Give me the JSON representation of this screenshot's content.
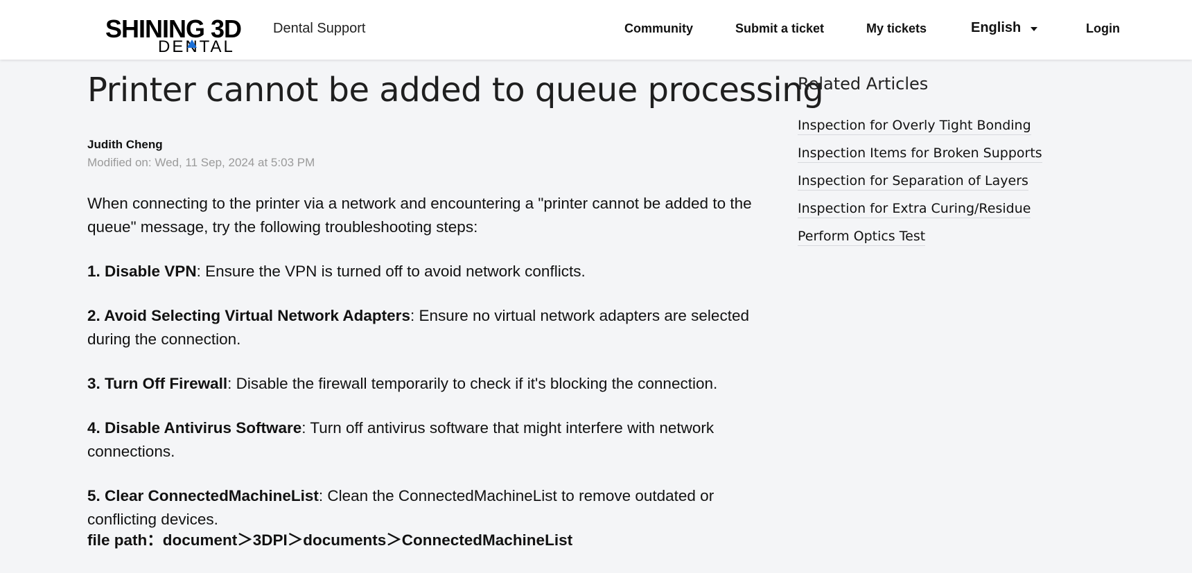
{
  "header": {
    "logo_line1": "SHINING 3D",
    "logo_line2": "DENTAL",
    "brand_sub": "Dental Support",
    "nav": {
      "community": "Community",
      "submit_ticket": "Submit a ticket",
      "my_tickets": "My tickets",
      "language": "English",
      "login": "Login"
    }
  },
  "article": {
    "title": "Printer cannot be added to queue processing",
    "author": "Judith Cheng",
    "modified": "Modified on: Wed, 11 Sep, 2024 at 5:03 PM",
    "intro": "When connecting to the printer via a network and encountering a \"printer cannot be added to the queue\" message, try the following troubleshooting steps:",
    "steps": [
      {
        "title": "1. Disable VPN",
        "text": ": Ensure the VPN is turned off to avoid network conflicts."
      },
      {
        "title": "2. Avoid Selecting Virtual Network Adapters",
        "text": ": Ensure no virtual network adapters are selected during the connection."
      },
      {
        "title": "3. Turn Off Firewall",
        "text": ": Disable the firewall temporarily to check if it's blocking the connection."
      },
      {
        "title": "4. Disable Antivirus Software",
        "text": ": Turn off antivirus software that might interfere with network connections."
      },
      {
        "title": "5. Clear ConnectedMachineList",
        "text": ": Clean the ConnectedMachineList to remove outdated or conflicting devices."
      }
    ],
    "file_path": "file path：document＞3DPI＞documents＞ConnectedMachineList"
  },
  "related": {
    "title": "Related Articles",
    "items": [
      "Inspection for Overly Tight Bonding",
      "Inspection Items for Broken Supports",
      "Inspection for Separation of Layers",
      "Inspection for Extra Curing/Residue",
      "Perform Optics Test"
    ]
  },
  "colors": {
    "background": "#f4f5f7",
    "header": "#ffffff",
    "logo_accent": "#1a6fd6",
    "meta_text": "#9a9a9a"
  }
}
